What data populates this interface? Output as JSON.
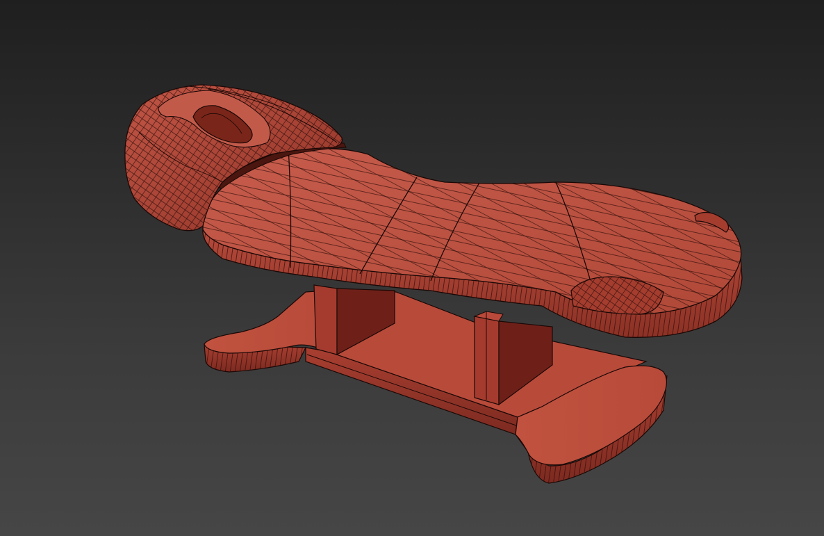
{
  "viewport": {
    "view_mode": "perspective",
    "shading": "edged faces"
  },
  "model": {
    "object": "massage-table",
    "parts": [
      "headrest",
      "bed-cushion",
      "lift-column",
      "base-plate"
    ]
  },
  "colors": {
    "background_top": "#1f1f1f",
    "background_bottom": "#464646",
    "mesh_fill": "#b34b3e",
    "mesh_fill_light": "#c45a4a",
    "mesh_fill_dark": "#8a3024",
    "mesh_shadow": "#5a1a12",
    "wireframe": "#1a0806"
  },
  "icons": [
    "massage-table-mesh"
  ]
}
